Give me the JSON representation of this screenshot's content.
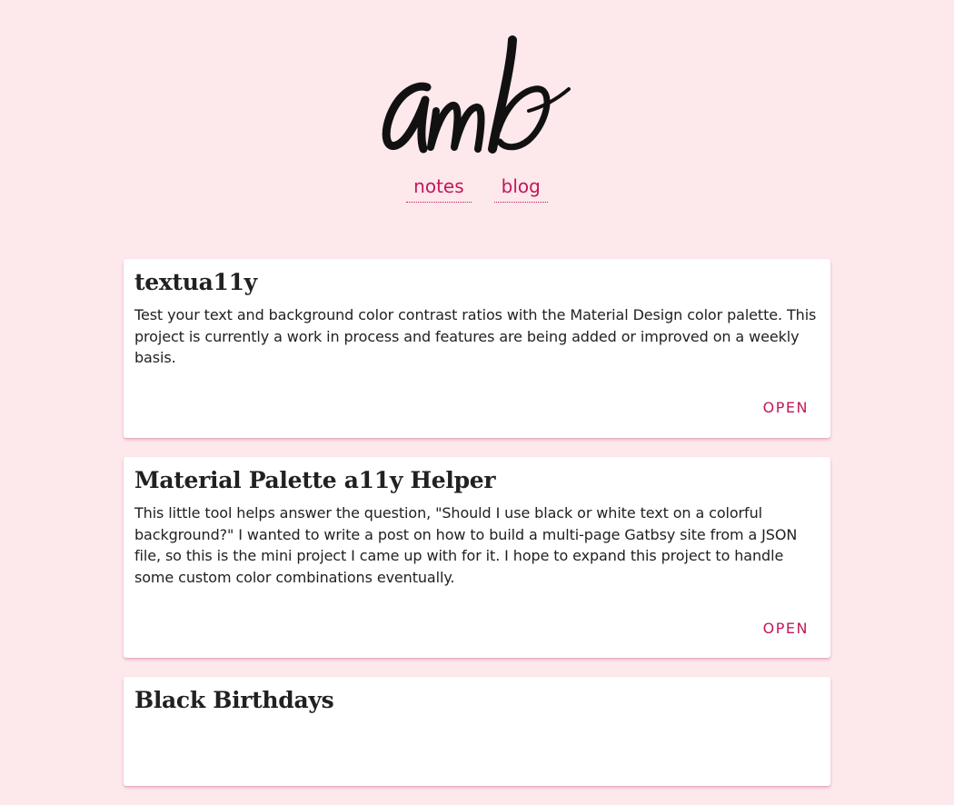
{
  "header": {
    "logo_text": "amb",
    "nav": [
      {
        "label": "notes"
      },
      {
        "label": "blog"
      }
    ]
  },
  "projects": [
    {
      "title": "textua11y",
      "description": "Test your text and background color contrast ratios with the Material Design color palette. This project is currently a work in process and features are being added or improved on a weekly basis.",
      "action": "OPEN"
    },
    {
      "title": "Material Palette a11y Helper",
      "description": "This little tool helps answer the question, \"Should I use black or white text on a colorful background?\" I wanted to write a post on how to build a multi-page Gatbsy site from a JSON file, so this is the mini project I came up with for it. I hope to expand this project to handle some custom color combinations eventually.",
      "action": "OPEN"
    },
    {
      "title": "Black Birthdays"
    }
  ],
  "colors": {
    "background": "#fde8ec",
    "accent": "#c2185b",
    "text": "#212121"
  }
}
